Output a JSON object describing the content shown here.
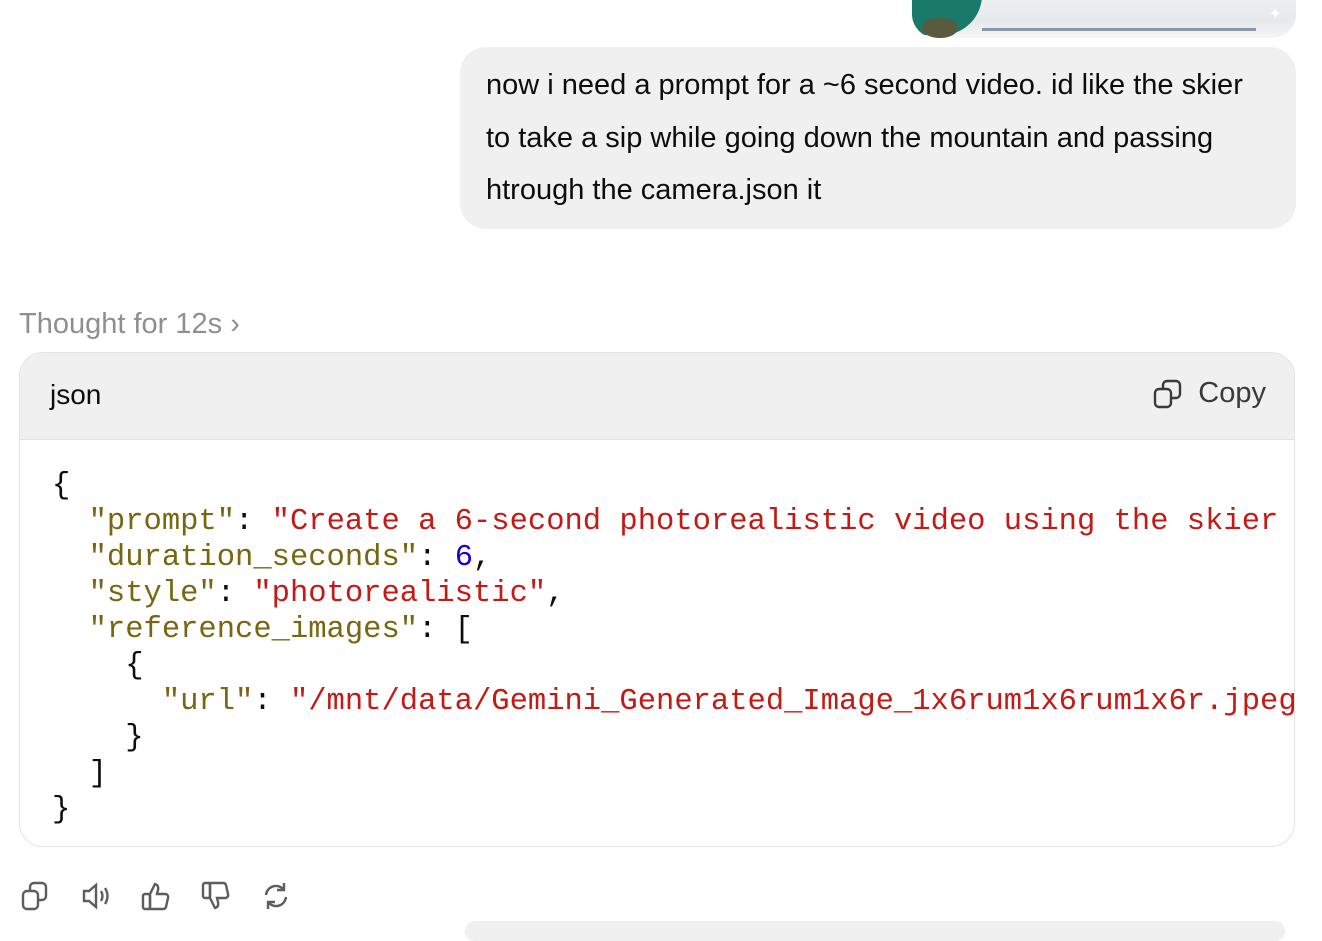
{
  "user_message": {
    "text": "now i need a prompt for a ~6 second video. id like the skier to take a sip while going down the mountain and passing htrough the camera.json it"
  },
  "assistant": {
    "thought_label": "Thought for 12s",
    "code_block": {
      "language": "json",
      "copy_label": "Copy",
      "lines": {
        "l1": "{",
        "prompt_key": "\"prompt\"",
        "prompt_val": "\"Create a 6-second photorealistic video using the skier",
        "duration_key": "\"duration_seconds\"",
        "duration_val": "6",
        "style_key": "\"style\"",
        "style_val": "\"photorealistic\"",
        "ref_key": "\"reference_images\"",
        "url_key": "\"url\"",
        "url_val": "\"/mnt/data/Gemini_Generated_Image_1x6rum1x6rum1x6r.jpeg"
      }
    },
    "actions": [
      "copy-icon",
      "speaker-icon",
      "thumbs-up-icon",
      "thumbs-down-icon",
      "regenerate-icon"
    ]
  }
}
